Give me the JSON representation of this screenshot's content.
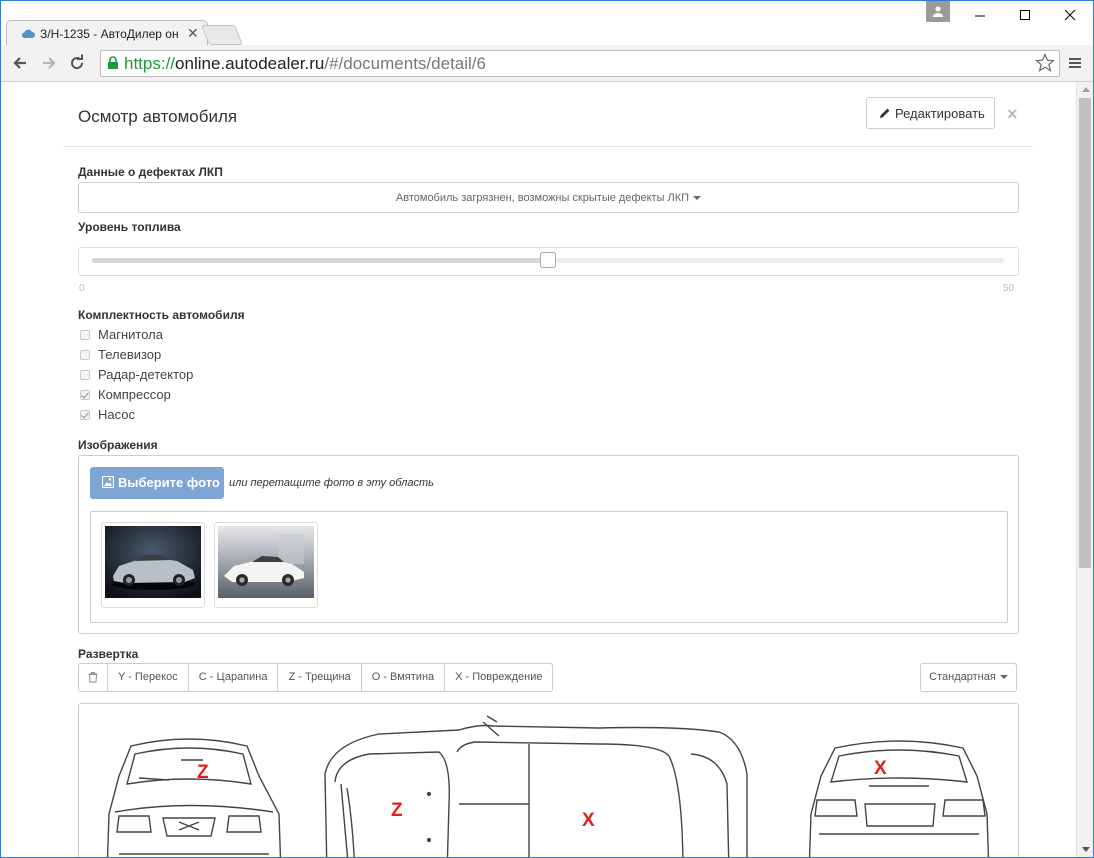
{
  "browser": {
    "tab_title": "З/Н-1235 - АвтоДилер он",
    "url_scheme": "https://",
    "url_host": "online.autodealer.ru",
    "url_path": "/#/documents/detail/6"
  },
  "modal": {
    "title": "Осмотр автомобиля",
    "edit_button": "Редактировать",
    "close_symbol": "×"
  },
  "paint_defects": {
    "label": "Данные о дефектах ЛКП",
    "selected": "Автомобиль загрязнен, возможны скрытые дефекты ЛКП"
  },
  "fuel": {
    "label": "Уровень топлива",
    "min": "0",
    "max": "50",
    "value": 25
  },
  "equipment": {
    "label": "Комплектность автомобиля",
    "items": [
      {
        "label": "Магнитола",
        "checked": false
      },
      {
        "label": "Телевизор",
        "checked": false
      },
      {
        "label": "Радар-детектор",
        "checked": false
      },
      {
        "label": "Компрессор",
        "checked": true
      },
      {
        "label": "Насос",
        "checked": true
      }
    ]
  },
  "images": {
    "label": "Изображения",
    "choose_button": "Выберите фото",
    "drop_hint": "или перетащите фото в эту область",
    "thumbnails": [
      "silver-sports-car-photo",
      "white-sports-car-photo"
    ]
  },
  "layout_scheme": {
    "label": "Развертка",
    "tools": [
      {
        "name": "trash-icon"
      },
      {
        "label": "Y - Перекос"
      },
      {
        "label": "C - Царапина"
      },
      {
        "label": "Z - Трещина"
      },
      {
        "label": "O - Вмятина"
      },
      {
        "label": "X - Повреждение"
      }
    ],
    "view_select": "Стандартная",
    "marks": [
      "Z",
      "Z",
      "X",
      "X"
    ]
  },
  "colors": {
    "primary_button": "#7ea5d3",
    "mark_red": "#e02020",
    "url_green": "#1d9a3f"
  }
}
